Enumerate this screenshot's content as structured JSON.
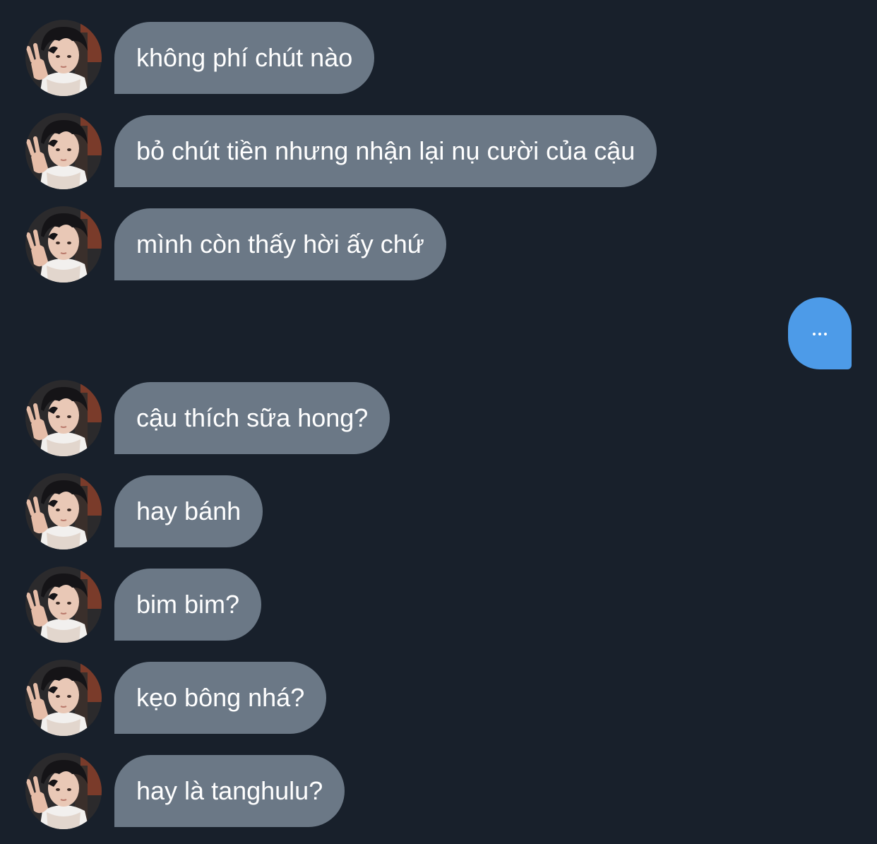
{
  "chat": {
    "incoming": [
      {
        "text": "không phí chút nào"
      },
      {
        "text": "bỏ chút tiền nhưng nhận lại nụ cười của cậu"
      },
      {
        "text": "mình còn thấy hời ấy chứ"
      },
      {
        "text": "cậu thích sữa hong?"
      },
      {
        "text": "hay bánh"
      },
      {
        "text": "bim bim?"
      },
      {
        "text": "kẹo bông nhá?"
      },
      {
        "text": "hay là tanghulu?"
      }
    ],
    "outgoing": {
      "icon": "typing-dots-icon"
    }
  },
  "colors": {
    "background": "#18202b",
    "incoming_bubble": "#6b7886",
    "outgoing_bubble": "#4d9be8",
    "text": "#ffffff"
  }
}
